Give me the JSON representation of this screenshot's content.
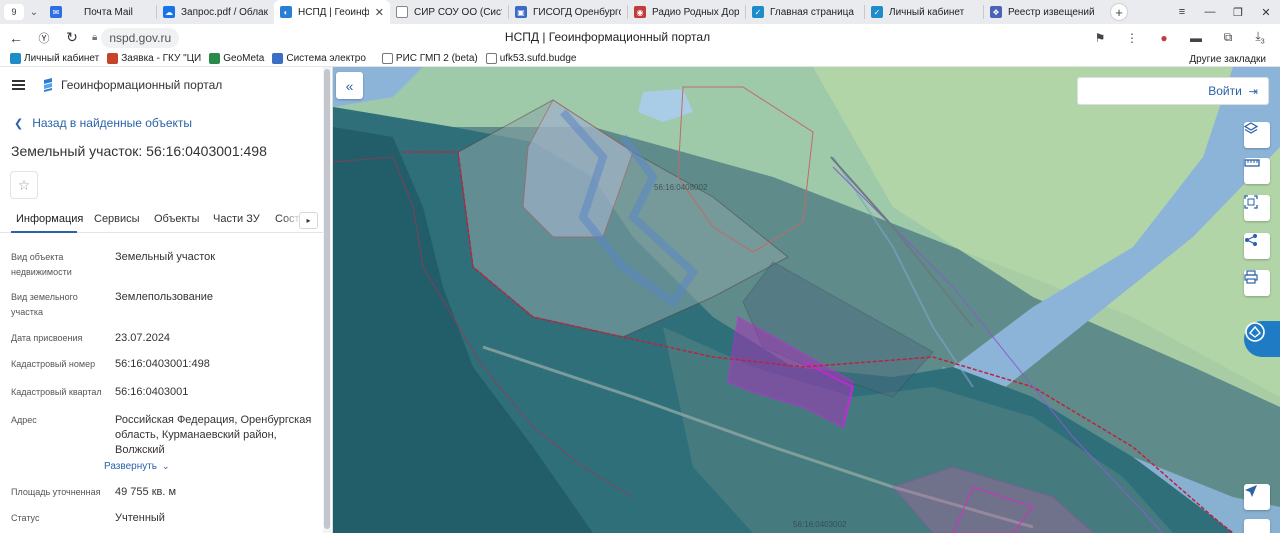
{
  "browser": {
    "tab_counter": "9",
    "tabs": [
      {
        "label": "Почта Mail",
        "icon": "mail-icon",
        "color": "#2f6fe4",
        "active": false
      },
      {
        "label": "Запрос.pdf / Облако",
        "icon": "cloud-icon",
        "color": "#1a73e8",
        "active": false
      },
      {
        "label": "НСПД | Геоинфорг",
        "icon": "nspd-icon",
        "color": "#2a7fd4",
        "active": true
      },
      {
        "label": "СИР СОУ ОО (Систем",
        "icon": "doc-icon",
        "color": "#555555",
        "active": false
      },
      {
        "label": "ГИСОГД Оренбургск",
        "icon": "gis-icon",
        "color": "#3b6bc4",
        "active": false
      },
      {
        "label": "Радио Родных Дорог",
        "icon": "radio-icon",
        "color": "#c43b3b",
        "active": false
      },
      {
        "label": "Главная страница",
        "icon": "portal-icon",
        "color": "#1e8cc8",
        "active": false
      },
      {
        "label": "Личный кабинет",
        "icon": "portal-icon",
        "color": "#1e8cc8",
        "active": false
      },
      {
        "label": "Реестр извещений",
        "icon": "emblem-icon",
        "color": "#4a63b8",
        "active": false
      }
    ],
    "url": "nspd.gov.ru",
    "page_title": "НСПД | Геоинформационный портал",
    "bookmarks": [
      {
        "label": "Личный кабинет",
        "color": "#1e8cc8"
      },
      {
        "label": "Заявка - ГКУ \"ЦИ",
        "color": "#c8432a"
      },
      {
        "label": "GeoMeta",
        "color": "#2a8a4a"
      },
      {
        "label": "Система электро",
        "color": "#3a6fc4"
      },
      {
        "label": "РИС ГМП 2 (beta)",
        "color": "#666666"
      },
      {
        "label": "ufk53.sufd.budge",
        "color": "#666666"
      }
    ],
    "other_bookmarks": "Другие закладки",
    "badge_count": "3"
  },
  "panel": {
    "portal_name": "Геоинформационный портал",
    "back_link": "Назад в найденные объекты",
    "title": "Земельный участок: 56:16:0403001:498",
    "tabs": [
      "Информация",
      "Сервисы",
      "Объекты",
      "Части ЗУ",
      "Соста"
    ],
    "attributes": [
      {
        "label": "Вид объекта недвижимости",
        "value": "Земельный участок"
      },
      {
        "label": "Вид земельного участка",
        "value": "Землепользование"
      },
      {
        "label": "Дата присвоения",
        "value": "23.07.2024"
      },
      {
        "label": "Кадастровый номер",
        "value": "56:16:0403001:498"
      },
      {
        "label": "Кадастровый квартал",
        "value": "56:16:0403001"
      },
      {
        "label": "Адрес",
        "value": "Российская Федерация, Оренбургская область, Курманаевский район, Волжский"
      },
      {
        "label": "Площадь уточненная",
        "value": "49 755 кв. м"
      },
      {
        "label": "Статус",
        "value": "Учтенный"
      }
    ],
    "expand_link": "Развернуть"
  },
  "map": {
    "login_label": "Войти",
    "quarter_label_1": "56:16:0408002",
    "quarter_label_2": "56:16:0403002",
    "tools": [
      "layers-icon",
      "ruler-icon",
      "select-area-icon",
      "share-icon",
      "print-icon",
      "locate-icon"
    ],
    "colors": {
      "river": "#8cb4d8",
      "field": "#9cc9a8",
      "forest": "#2f6f7a",
      "parcel_highlight": "#b020c8",
      "boundary": "#c06a6a"
    }
  }
}
